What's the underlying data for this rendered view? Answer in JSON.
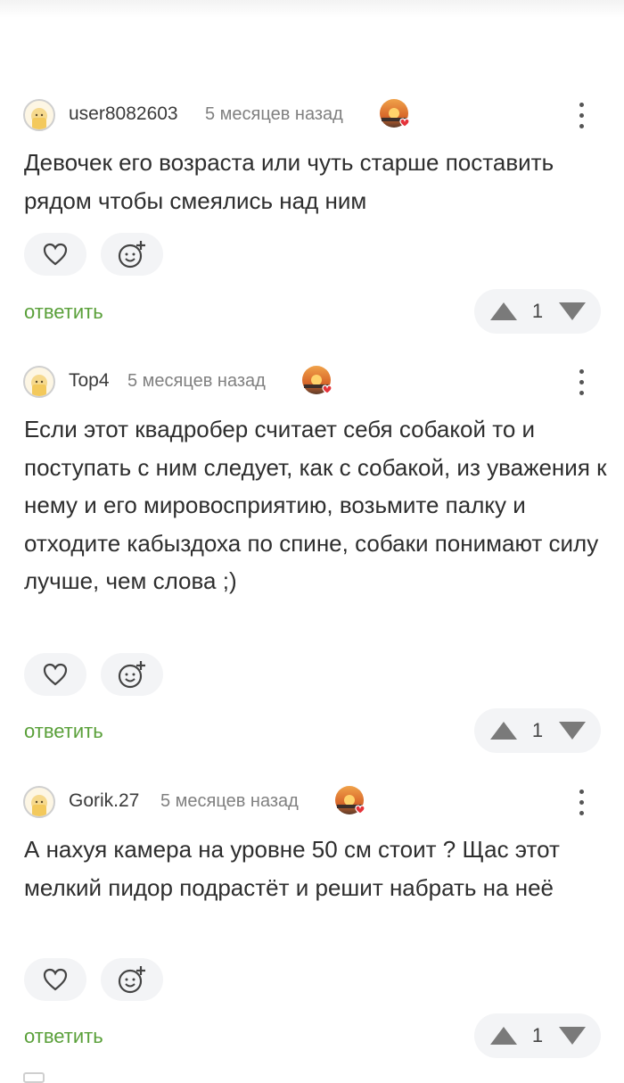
{
  "comments": [
    {
      "username": "user8082603",
      "time": "5 месяцев назад",
      "text": "Девочек его возраста или чуть старше поставить рядом чтобы смеялись над ним",
      "reply_label": "ответить",
      "rating": "1"
    },
    {
      "username": "Top4",
      "time": "5 месяцев назад",
      "text": "Если этот квадробер считает себя собакой то и поступать с ним следует, как с собакой, из уважения к нему и его мировосприятию, возьмите палку и отходите кабыздоха по спине, собаки понимают силу лучше, чем слова ;)",
      "reply_label": "ответить",
      "rating": "1"
    },
    {
      "username": "Gorik.27",
      "time": "5 месяцев назад",
      "text": "А нахуя камера на уровне 50 см стоит ? Щас этот мелкий пидор подрастёт и решит набрать на неё",
      "reply_label": "ответить",
      "rating": "1"
    }
  ],
  "icons": {
    "avatar": "default-avatar-icon",
    "badge": "sunset-heart-badge-icon",
    "menu": "more-vertical-icon",
    "like": "heart-icon",
    "reaction": "add-emoji-icon",
    "upvote": "triangle-up-icon",
    "downvote": "triangle-down-icon"
  },
  "colors": {
    "reply": "#5aa03a",
    "pill_bg": "#f3f4f6",
    "vote_icon": "#7a7a7a"
  }
}
